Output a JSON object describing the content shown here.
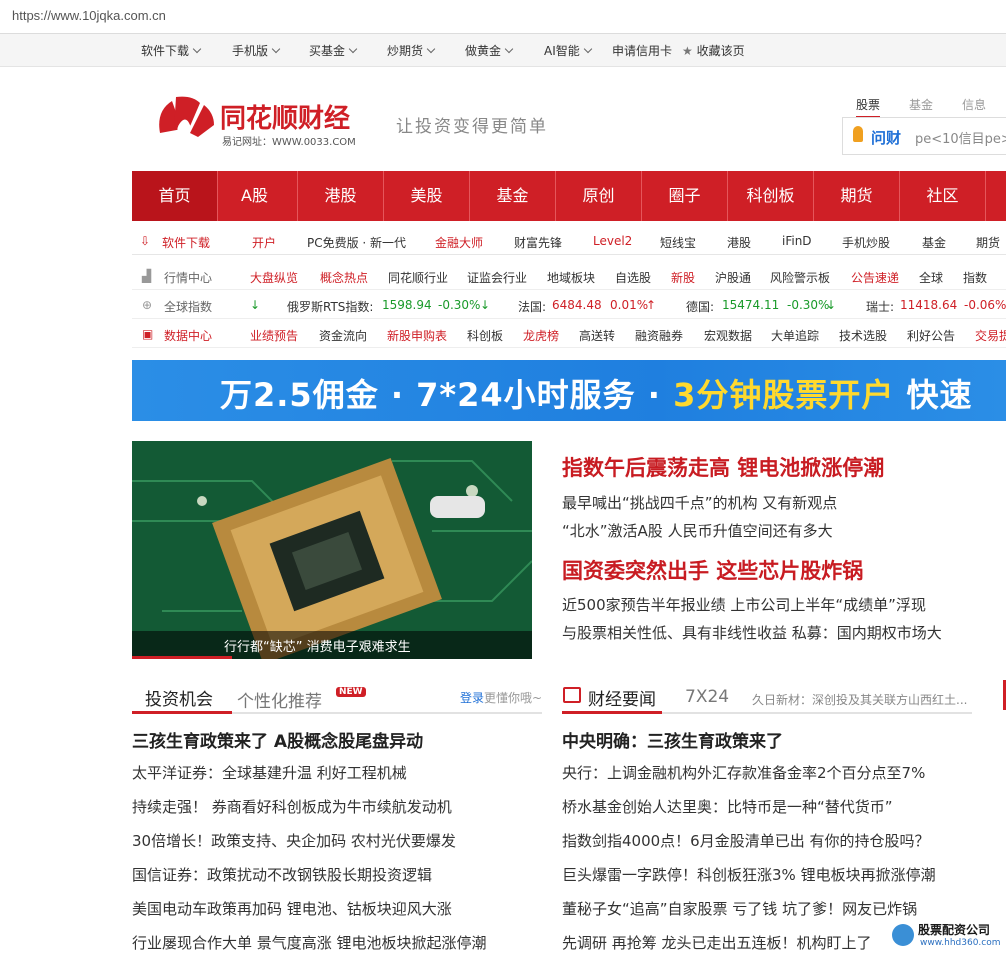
{
  "browser": {
    "url": "https://www.10jqka.com.cn"
  },
  "topnav": {
    "items": [
      "软件下载",
      "手机版",
      "买基金",
      "炒期货",
      "做黄金",
      "AI智能",
      "申请信用卡"
    ],
    "bookmark": "收藏该页"
  },
  "logo": {
    "name": "同花顺财经",
    "sub": "易记网址：WWW.0033.COM"
  },
  "slogan": "让投资变得更简单",
  "search": {
    "tabs": [
      "股票",
      "基金",
      "信息"
    ],
    "brand": "问财",
    "placeholder": "pe<10信目pe>"
  },
  "mainnav": [
    "首页",
    "A股",
    "港股",
    "美股",
    "基金",
    "原创",
    "圈子",
    "科创板",
    "期货",
    "社区"
  ],
  "software_row": {
    "label": "软件下载",
    "items": [
      "开户",
      "PC免费版 · 新一代",
      "金融大师",
      "财富先锋",
      "Level2",
      "短线宝",
      "港股",
      "iFinD",
      "手机炒股",
      "基金",
      "期货"
    ]
  },
  "quote_row": {
    "label": "行情中心",
    "items": [
      "大盘纵览",
      "概念热点",
      "同花顺行业",
      "证监会行业",
      "地域板块",
      "自选股",
      "新股",
      "沪股通",
      "风险警示板",
      "公告速递",
      "全球",
      "指数"
    ]
  },
  "global_row": {
    "label": "全球指数",
    "indices": [
      {
        "name": "俄罗斯RTS指数:",
        "value": "1598.94",
        "change": "-0.30%"
      },
      {
        "name": "法国:",
        "value": "6484.48",
        "change": "0.01%"
      },
      {
        "name": "德国:",
        "value": "15474.11",
        "change": "-0.30%"
      },
      {
        "name": "瑞士:",
        "value": "11418.64",
        "change": "-0.06%"
      }
    ]
  },
  "data_row": {
    "label": "数据中心",
    "items": [
      "业绩预告",
      "资金流向",
      "新股申购表",
      "科创板",
      "龙虎榜",
      "高送转",
      "融资融券",
      "宏观数据",
      "大单追踪",
      "技术选股",
      "利好公告",
      "交易提"
    ]
  },
  "banner": {
    "part1": "万2.5佣金 · 7*24小时服务 · ",
    "part2": "3分钟股票开户",
    "part3": "快速"
  },
  "hero": {
    "caption": "行行都“缺芯” 消费电子艰难求生"
  },
  "headlines": [
    {
      "title": "指数午后震荡走高 锂电池掀涨停潮",
      "lines": [
        "最早喊出“挑战四千点”的机构 又有新观点",
        "“北水”激活A股 人民币升值空间还有多大"
      ]
    },
    {
      "title": "国资委突然出手 这些芯片股炸锅",
      "lines": [
        "近500家预告半年报业绩 上市公司上半年“成绩单”浮现",
        "与股票相关性低、具有非线性收益 私募：国内期权市场大"
      ]
    }
  ],
  "left_section": {
    "tab1": "投资机会",
    "tab2": "个性化推荐",
    "new": "NEW",
    "login": "登录",
    "login_tail": "更懂你哦~",
    "top": "三孩生育政策来了 A股概念股尾盘异动",
    "items": [
      "太平洋证券：全球基建升温 利好工程机械",
      "持续走强！ 券商看好科创板成为牛市续航发动机",
      "30倍增长！政策支持、央企加码 农村光伏要爆发",
      "国信证券：政策扰动不改钢铁股长期投资逻辑",
      "美国电动车政策再加码 锂电池、钴板块迎风大涨",
      "行业屡现合作大单 景气度高涨 锂电池板块掀起涨停潮"
    ]
  },
  "right_section": {
    "tab1": "财经要闻",
    "tab2": "7X24",
    "ticker": "久日新材：深创投及其关联方山西红土...",
    "top": "中央明确：三孩生育政策来了",
    "items": [
      "央行：上调金融机构外汇存款准备金率2个百分点至7%",
      "桥水基金创始人达里奥：比特币是一种“替代货币”",
      "指数剑指4000点！6月金股清单已出 有你的持仓股吗？",
      "巨头爆雷一字跌停！科创板狂涨3% 锂电板块再掀涨停潮",
      "董秘子女“追高”自家股票 亏了钱 坑了爹！网友已炸锅",
      "先调研 再抢筹 龙头已走出五连板！机构盯上了"
    ]
  },
  "watermark": {
    "name": "股票配资公司",
    "site": "www.hhd360.com"
  }
}
